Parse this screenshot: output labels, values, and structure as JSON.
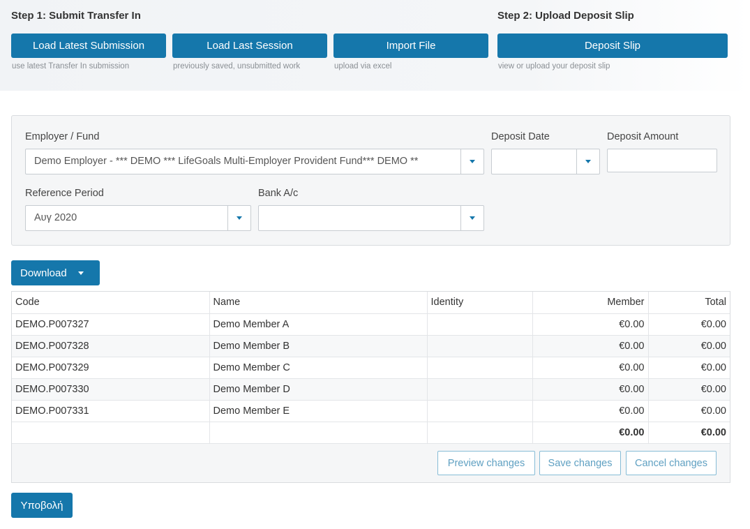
{
  "step1": {
    "title": "Step 1: Submit Transfer In",
    "buttons": [
      {
        "label": "Load Latest Submission",
        "hint": "use latest Transfer In submission"
      },
      {
        "label": "Load Last Session",
        "hint": "previously saved, unsubmitted work"
      },
      {
        "label": "Import File",
        "hint": "upload via excel"
      }
    ]
  },
  "step2": {
    "title": "Step 2: Upload Deposit Slip",
    "button": {
      "label": "Deposit Slip",
      "hint": "view or upload your deposit slip"
    }
  },
  "form": {
    "employer_fund": {
      "label": "Employer / Fund",
      "value": "Demo Employer - *** DEMO *** LifeGoals Multi-Employer Provident Fund*** DEMO **"
    },
    "deposit_date": {
      "label": "Deposit Date",
      "value": ""
    },
    "deposit_amount": {
      "label": "Deposit Amount",
      "value": ""
    },
    "reference_period": {
      "label": "Reference Period",
      "value": "Αυγ 2020"
    },
    "bank_account": {
      "label": "Bank A/c",
      "value": ""
    }
  },
  "download": {
    "label": "Download"
  },
  "table": {
    "columns": [
      "Code",
      "Name",
      "Identity",
      "Member",
      "Total"
    ],
    "rows": [
      {
        "code": "DEMO.P007327",
        "name": "Demo Member A",
        "identity": "",
        "member": "€0.00",
        "total": "€0.00"
      },
      {
        "code": "DEMO.P007328",
        "name": "Demo Member B",
        "identity": "",
        "member": "€0.00",
        "total": "€0.00"
      },
      {
        "code": "DEMO.P007329",
        "name": "Demo Member C",
        "identity": "",
        "member": "€0.00",
        "total": "€0.00"
      },
      {
        "code": "DEMO.P007330",
        "name": "Demo Member D",
        "identity": "",
        "member": "€0.00",
        "total": "€0.00"
      },
      {
        "code": "DEMO.P007331",
        "name": "Demo Member E",
        "identity": "",
        "member": "€0.00",
        "total": "€0.00"
      }
    ],
    "totals": {
      "member": "€0.00",
      "total": "€0.00"
    }
  },
  "grid_actions": {
    "preview": "Preview changes",
    "save": "Save changes",
    "cancel": "Cancel changes"
  },
  "submit": {
    "label": "Υποβολή"
  },
  "colors": {
    "primary": "#1577ab",
    "outline_button_text": "#5fa0c2"
  }
}
